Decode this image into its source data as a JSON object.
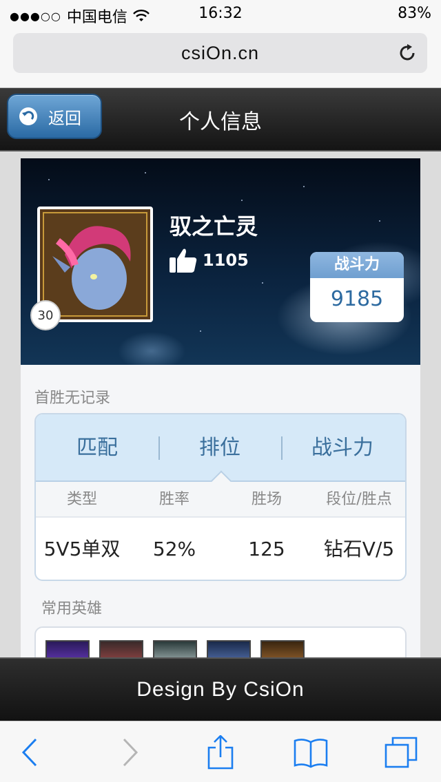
{
  "status_bar": {
    "carrier": "中国电信",
    "signal_dots": "●●●○○",
    "time": "16:32",
    "battery": "83%"
  },
  "browser": {
    "url": "csiOn.cn"
  },
  "header": {
    "back_label": "返回",
    "title": "个人信息"
  },
  "profile": {
    "name": "驭之亡灵",
    "likes": "1105",
    "level": "30",
    "power_label": "战斗力",
    "power_value": "9185"
  },
  "first_win": "首胜无记录",
  "tabs": [
    "匹配",
    "排位",
    "战斗力"
  ],
  "active_tab": "排位",
  "table": {
    "headers": [
      "类型",
      "胜率",
      "胜场",
      "段位/胜点"
    ],
    "rows": [
      [
        "5V5单双",
        "52%",
        "125",
        "钻石V/5"
      ]
    ]
  },
  "heroes_title": "常用英雄",
  "footer": "Design By CsiOn",
  "colors": {
    "accent": "#2d6aa0",
    "tab_bg": "#d6e9f8",
    "ios_blue": "#1b7ef0"
  },
  "icons": [
    "wifi-icon",
    "reload-icon",
    "back-arrow-icon",
    "thumbs-up-icon",
    "nav-back-icon",
    "nav-forward-icon",
    "share-icon",
    "bookmarks-icon",
    "tabs-icon"
  ]
}
